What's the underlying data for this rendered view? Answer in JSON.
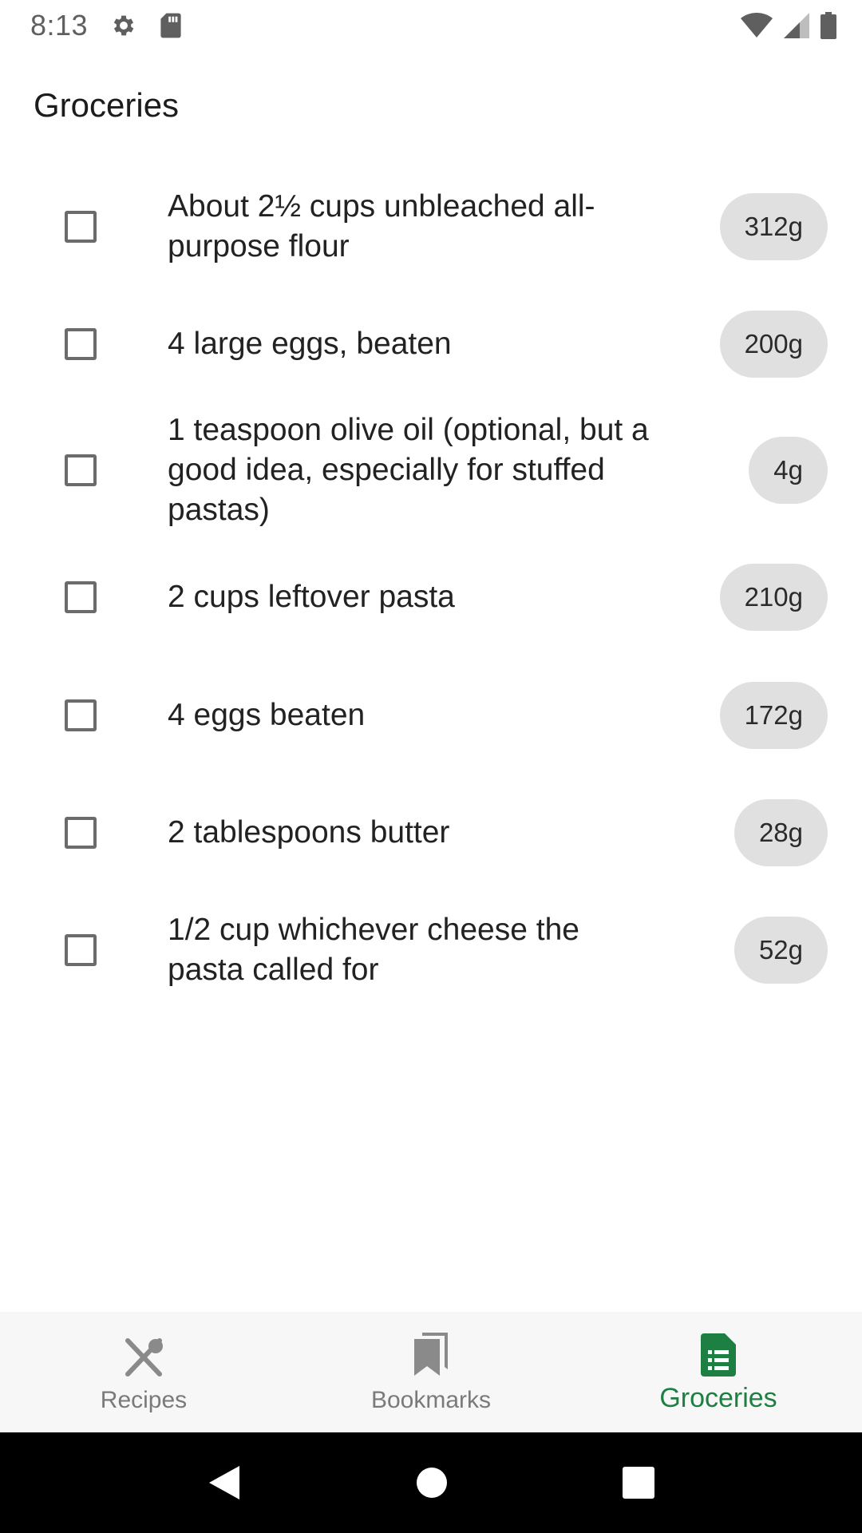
{
  "status_bar": {
    "time": "8:13",
    "icons": [
      "settings-icon",
      "sd-card-icon",
      "wifi-icon",
      "signal-icon",
      "battery-icon"
    ]
  },
  "header": {
    "title": "Groceries"
  },
  "items": [
    {
      "text": "About 2½ cups unbleached all-purpose flour",
      "weight": "312g",
      "checked": false
    },
    {
      "text": "4 large eggs, beaten",
      "weight": "200g",
      "checked": false
    },
    {
      "text": "1 teaspoon olive oil (optional, but a good idea, especially for stuffed pastas)",
      "weight": "4g",
      "checked": false
    },
    {
      "text": "2 cups leftover pasta",
      "weight": "210g",
      "checked": false
    },
    {
      "text": "4 eggs beaten",
      "weight": "172g",
      "checked": false
    },
    {
      "text": "2 tablespoons butter",
      "weight": "28g",
      "checked": false
    },
    {
      "text": "1/2 cup whichever cheese the pasta called for",
      "weight": "52g",
      "checked": false
    }
  ],
  "bottom_nav": {
    "items": [
      {
        "label": "Recipes",
        "icon": "fork-spoon-icon",
        "active": false
      },
      {
        "label": "Bookmarks",
        "icon": "bookmarks-icon",
        "active": false
      },
      {
        "label": "Groceries",
        "icon": "list-icon",
        "active": true
      }
    ]
  },
  "colors": {
    "accent": "#1e7f43",
    "chip": "#e0e0e0"
  }
}
